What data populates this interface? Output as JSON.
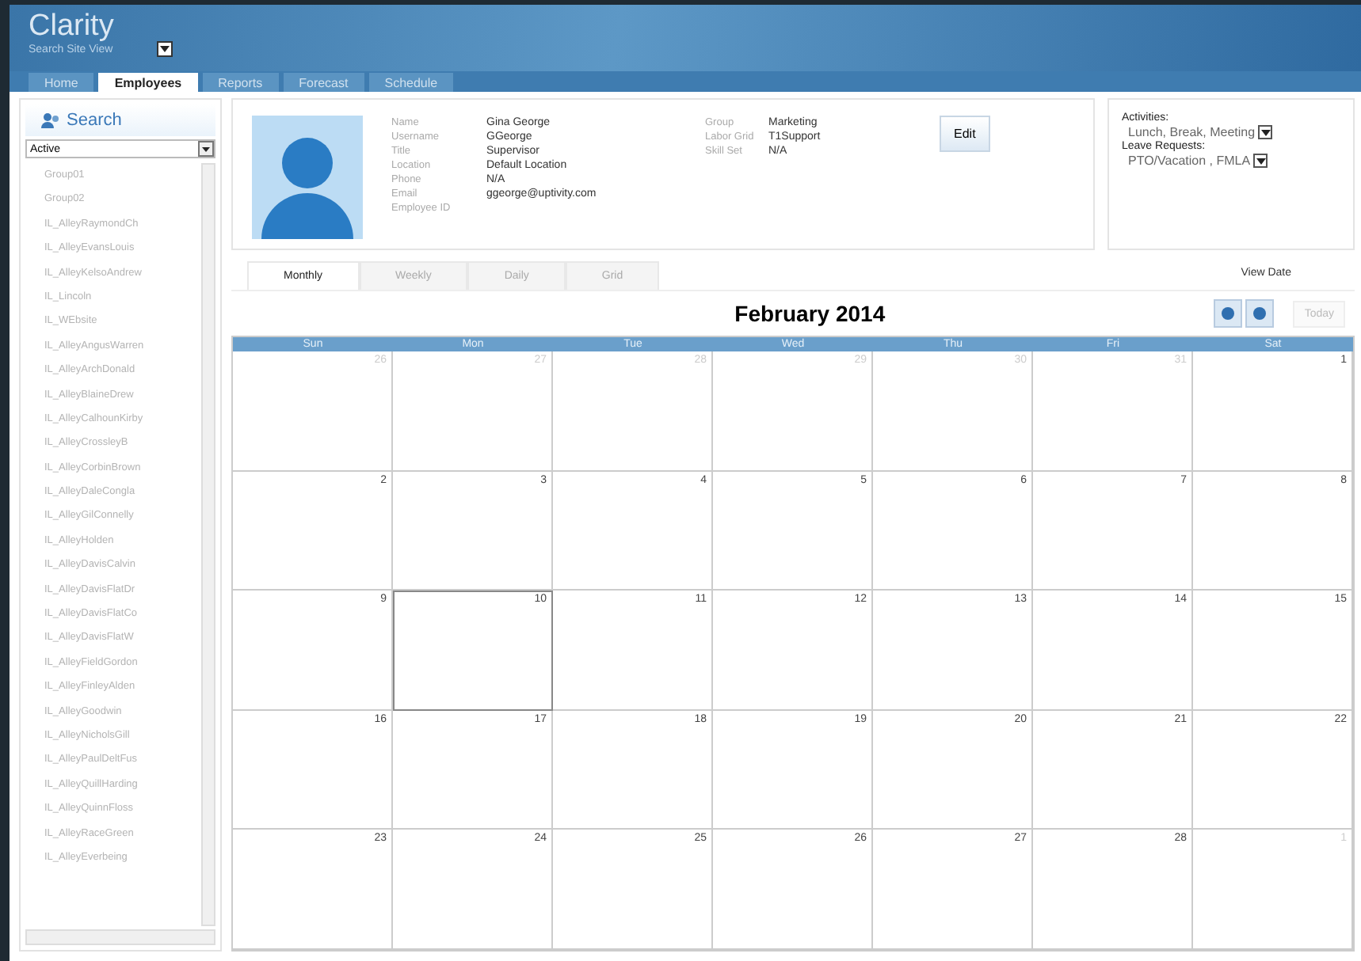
{
  "app": {
    "title": "Clarity",
    "site_view": "Search Site View"
  },
  "nav_tabs": [
    {
      "label": "Home",
      "selected": false
    },
    {
      "label": "Employees",
      "selected": true
    },
    {
      "label": "Reports",
      "selected": false
    },
    {
      "label": "Forecast",
      "selected": false
    },
    {
      "label": "Schedule",
      "selected": false
    }
  ],
  "sidebar": {
    "search_label": "Search",
    "filter": "Active",
    "items": [
      "Group01",
      "Group02",
      "IL_AlleyRaymondCh",
      "IL_AlleyEvansLouis",
      "IL_AlleyKelsoAndrew",
      "IL_Lincoln",
      "IL_WEbsite",
      "IL_AlleyAngusWarren",
      "IL_AlleyArchDonald",
      "IL_AlleyBlaineDrew",
      "IL_AlleyCalhounKirby",
      "IL_AlleyCrossleyB",
      "IL_AlleyCorbinBrown",
      "IL_AlleyDaleCongla",
      "IL_AlleyGilConnelly",
      "IL_AlleyHolden",
      "IL_AlleyDavisCalvin",
      "IL_AlleyDavisFlatDr",
      "IL_AlleyDavisFlatCo",
      "IL_AlleyDavisFlatW",
      "IL_AlleyFieldGordon",
      "IL_AlleyFinleyAlden",
      "IL_AlleyGoodwin",
      "IL_AlleyNicholsGill",
      "IL_AlleyPaulDeltFus",
      "IL_AlleyQuillHarding",
      "IL_AlleyQuinnFloss",
      "IL_AlleyRaceGreen",
      "IL_AlleyEverbeing"
    ]
  },
  "profile": {
    "fields": [
      {
        "label": "Name",
        "value": "Gina George"
      },
      {
        "label": "Username",
        "value": "GGeorge"
      },
      {
        "label": "Title",
        "value": "Supervisor"
      },
      {
        "label": "Location",
        "value": "Default Location"
      },
      {
        "label": "Phone",
        "value": "N/A"
      },
      {
        "label": "Email",
        "value": "ggeorge@uptivity.com"
      },
      {
        "label": "Employee ID"
      }
    ],
    "fields_2": [
      {
        "label": "Group",
        "value": "Marketing"
      },
      {
        "label": "Labor Grid",
        "value": "T1Support"
      },
      {
        "label": "Skill Set",
        "value": "N/A"
      }
    ],
    "edit_button": "Edit"
  },
  "preferences": {
    "activities_label": "Activities:",
    "activities": "Lunch, Break, Meeting",
    "leave_label": "Leave Requests:",
    "leave": "PTO/Vacation , FMLA"
  },
  "view_tabs": [
    {
      "label": "Monthly",
      "selected": true
    },
    {
      "label": "Weekly",
      "selected": false
    },
    {
      "label": "Daily",
      "selected": false
    },
    {
      "label": "Grid",
      "selected": false
    }
  ],
  "view_date_label": "View Date",
  "calendar": {
    "title": "February 2014",
    "today_button": "Today",
    "days": [
      "Sun",
      "Mon",
      "Tue",
      "Wed",
      "Thu",
      "Fri",
      "Sat"
    ],
    "weeks": [
      [
        {
          "day": "26",
          "outside": true,
          "selected": false
        },
        {
          "day": "27",
          "outside": true,
          "selected": false
        },
        {
          "day": "28",
          "outside": true,
          "selected": false
        },
        {
          "day": "29",
          "outside": true,
          "selected": false
        },
        {
          "day": "30",
          "outside": true,
          "selected": false
        },
        {
          "day": "31",
          "outside": true,
          "selected": false
        },
        {
          "day": "1",
          "outside": false,
          "selected": false
        }
      ],
      [
        {
          "day": "2",
          "outside": false,
          "selected": false
        },
        {
          "day": "3",
          "outside": false,
          "selected": false
        },
        {
          "day": "4",
          "outside": false,
          "selected": false
        },
        {
          "day": "5",
          "outside": false,
          "selected": false
        },
        {
          "day": "6",
          "outside": false,
          "selected": false
        },
        {
          "day": "7",
          "outside": false,
          "selected": false
        },
        {
          "day": "8",
          "outside": false,
          "selected": false
        }
      ],
      [
        {
          "day": "9",
          "outside": false,
          "selected": false
        },
        {
          "day": "10",
          "outside": false,
          "selected": true
        },
        {
          "day": "11",
          "outside": false,
          "selected": false
        },
        {
          "day": "12",
          "outside": false,
          "selected": false
        },
        {
          "day": "13",
          "outside": false,
          "selected": false
        },
        {
          "day": "14",
          "outside": false,
          "selected": false
        },
        {
          "day": "15",
          "outside": false,
          "selected": false
        }
      ],
      [
        {
          "day": "16",
          "outside": false,
          "selected": false
        },
        {
          "day": "17",
          "outside": false,
          "selected": false
        },
        {
          "day": "18",
          "outside": false,
          "selected": false
        },
        {
          "day": "19",
          "outside": false,
          "selected": false
        },
        {
          "day": "20",
          "outside": false,
          "selected": false
        },
        {
          "day": "21",
          "outside": false,
          "selected": false
        },
        {
          "day": "22",
          "outside": false,
          "selected": false
        }
      ],
      [
        {
          "day": "23",
          "outside": false,
          "selected": false
        },
        {
          "day": "24",
          "outside": false,
          "selected": false
        },
        {
          "day": "25",
          "outside": false,
          "selected": false
        },
        {
          "day": "26",
          "outside": false,
          "selected": false
        },
        {
          "day": "27",
          "outside": false,
          "selected": false
        },
        {
          "day": "28",
          "outside": false,
          "selected": false
        },
        {
          "day": "1",
          "outside": true,
          "selected": false
        }
      ]
    ]
  }
}
